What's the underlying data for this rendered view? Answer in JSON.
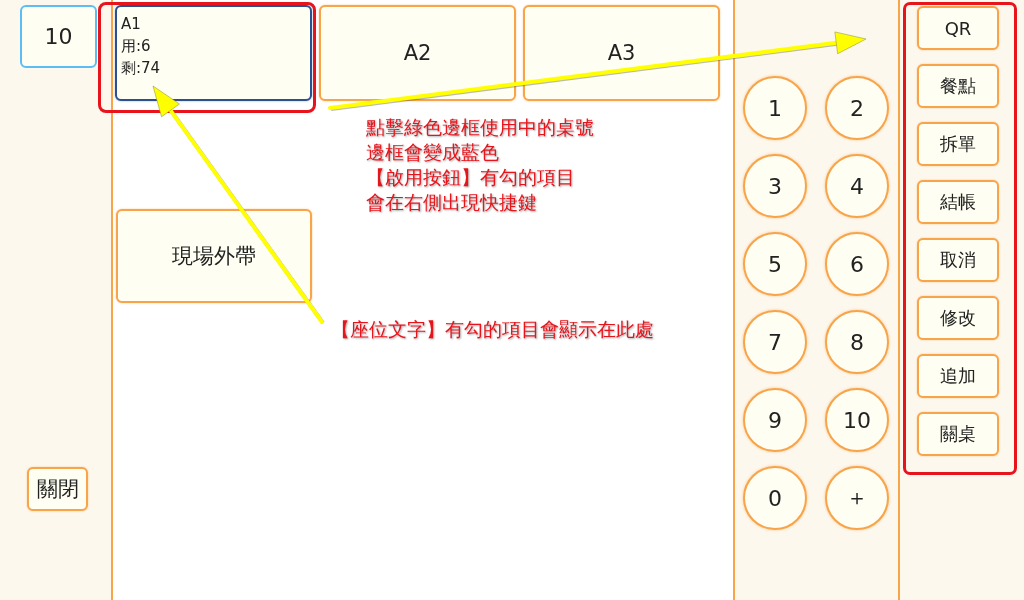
{
  "sidebar": {
    "display": "10",
    "close_button": "關閉"
  },
  "tables": [
    {
      "label": "A1",
      "details": [
        "用:6",
        "剩:74"
      ],
      "selected": true
    },
    {
      "label": "A2",
      "selected": false
    },
    {
      "label": "A3",
      "selected": false
    }
  ],
  "takeout": {
    "label": "現場外帶"
  },
  "keypad": {
    "keys": [
      "1",
      "2",
      "3",
      "4",
      "5",
      "6",
      "7",
      "8",
      "9",
      "10",
      "0",
      "＋"
    ]
  },
  "shortcuts": {
    "buttons": [
      "QR",
      "餐點",
      "拆單",
      "結帳",
      "取消",
      "修改",
      "追加",
      "關桌"
    ]
  },
  "annotations": {
    "notes": [
      {
        "lines": [
          "點擊綠色邊框使用中的桌號",
          "邊框會變成藍色",
          "【啟用按鈕】有勾的項目",
          "會在右側出現快捷鍵"
        ]
      },
      {
        "lines": [
          "【座位文字】有勾的項目會顯示在此處"
        ]
      }
    ]
  }
}
